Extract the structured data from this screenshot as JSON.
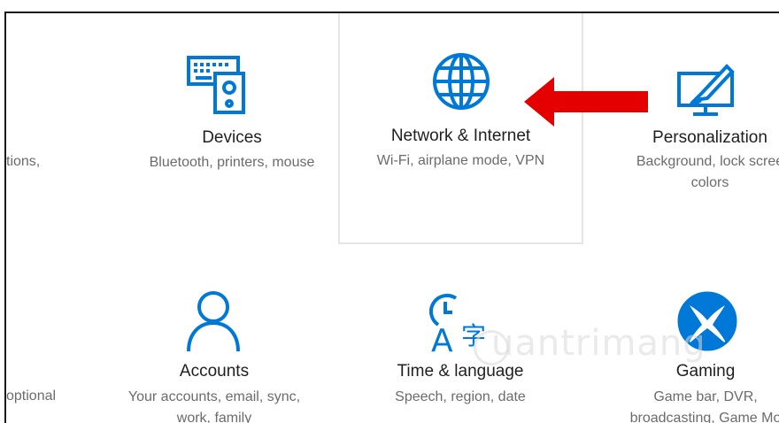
{
  "tiles": [
    {
      "title": "Devices",
      "desc1": "Bluetooth, printers, mouse",
      "desc2": "",
      "icon": "keyboard-speaker-icon"
    },
    {
      "title": "Network & Internet",
      "desc1": "Wi-Fi, airplane mode, VPN",
      "desc2": "",
      "icon": "globe-icon"
    },
    {
      "title": "Personalization",
      "desc1": "Background, lock scree",
      "desc2": "colors",
      "icon": "monitor-brush-icon"
    },
    {
      "title": "Accounts",
      "desc1": "Your accounts, email, sync,",
      "desc2": "work, family",
      "icon": "person-icon"
    },
    {
      "title": "Time & language",
      "desc1": "Speech, region, date",
      "desc2": "",
      "icon": "clock-language-icon"
    },
    {
      "title": "Gaming",
      "desc1": "Game bar, DVR,",
      "desc2": "broadcasting, Game Mo",
      "icon": "xbox-icon"
    }
  ],
  "partial": {
    "top": "tions,",
    "bottom": "optional"
  },
  "watermark": "uantrimang",
  "colors": {
    "accent": "#0078d7",
    "arrow": "#e50000"
  }
}
